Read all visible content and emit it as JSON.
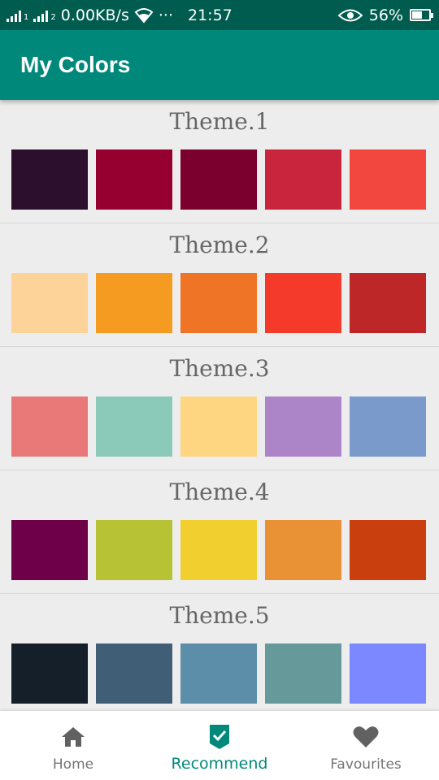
{
  "status_bar": {
    "network_speed": "0.00KB/s",
    "more": "···",
    "time": "21:57",
    "battery": "56%",
    "battery_level": 0.56
  },
  "app_bar": {
    "title": "My Colors"
  },
  "themes": [
    {
      "name": "Theme.1",
      "colors": [
        "#2c0f2c",
        "#960030",
        "#7c002e",
        "#c9253d",
        "#f2473f"
      ]
    },
    {
      "name": "Theme.2",
      "colors": [
        "#fdd39a",
        "#f59b22",
        "#f07426",
        "#f33a2b",
        "#bd2727"
      ]
    },
    {
      "name": "Theme.3",
      "colors": [
        "#e97878",
        "#8bc9b8",
        "#fed580",
        "#ac84c8",
        "#7b9acc"
      ]
    },
    {
      "name": "Theme.4",
      "colors": [
        "#6e0049",
        "#b7c235",
        "#f1cf2f",
        "#e89135",
        "#ca3f0e"
      ]
    },
    {
      "name": "Theme.5",
      "colors": [
        "#141f29",
        "#405e76",
        "#5c8ea9",
        "#66999a",
        "#7b88ff"
      ]
    }
  ],
  "bottom_nav": {
    "items": [
      {
        "label": "Home",
        "icon": "home-icon"
      },
      {
        "label": "Recommend",
        "icon": "check-shield-icon",
        "active": true
      },
      {
        "label": "Favourites",
        "icon": "heart-icon"
      }
    ]
  },
  "colors": {
    "status_bar": "#005c4f",
    "app_bar": "#00897b",
    "accent": "#00897b",
    "inactive_icon": "#757575"
  }
}
